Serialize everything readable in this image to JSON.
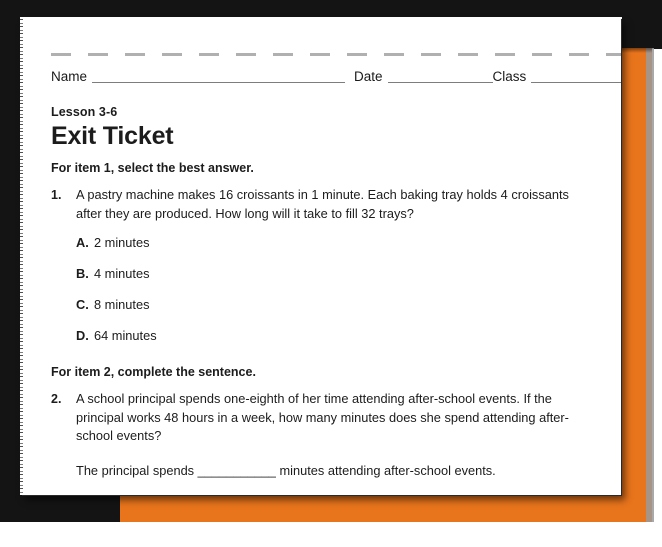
{
  "document": {
    "lesson_label": "Lesson 3-6",
    "title": "Exit Ticket",
    "header_fields": {
      "name_label": "Name",
      "date_label": "Date",
      "class_label": "Class"
    },
    "directives": {
      "item1": "For item 1, select the best answer.",
      "item2": "For item 2, complete the sentence."
    },
    "questions": [
      {
        "number": "1.",
        "text": "A pastry machine makes 16 croissants in 1 minute. Each baking tray holds 4 croissants after they are produced. How long will it take to fill 32 trays?",
        "choices": [
          {
            "letter": "A.",
            "text": "2 minutes"
          },
          {
            "letter": "B.",
            "text": "4 minutes"
          },
          {
            "letter": "C.",
            "text": "8 minutes"
          },
          {
            "letter": "D.",
            "text": "64 minutes"
          }
        ]
      },
      {
        "number": "2.",
        "text": "A school principal spends one-eighth of her time attending after-school events. If the principal works 48 hours in a week, how many minutes does she spend attending after-school events?",
        "answer_sentence": "The principal spends ___________ minutes attending after-school events."
      }
    ]
  },
  "colors": {
    "orange_band": "#E8741C",
    "black_band": "#141414",
    "page": "#ffffff",
    "text": "#1c1c1c",
    "rule": "#7d7d7d",
    "cutline": "#b0b0b0"
  }
}
